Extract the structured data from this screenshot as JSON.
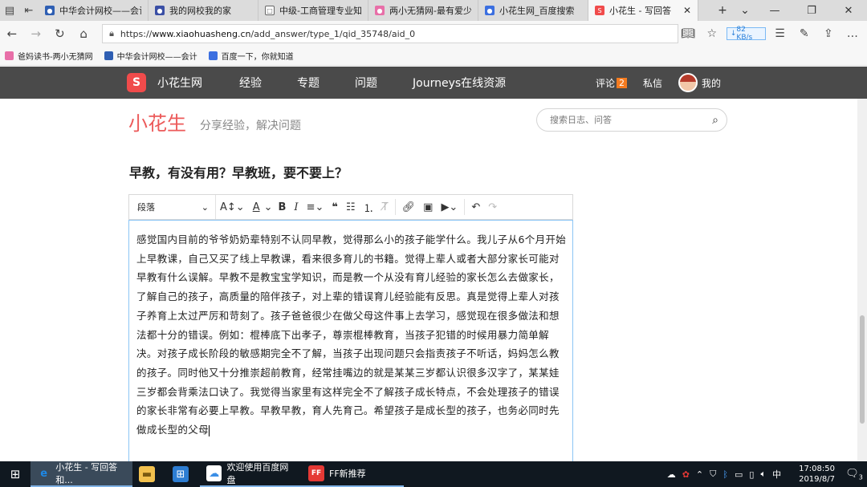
{
  "browser": {
    "tabs": [
      {
        "title": "中华会计网校——会计",
        "fav_color": "#2f5fb3"
      },
      {
        "title": "我的网校我的家",
        "fav_color": "#3a4fa5"
      },
      {
        "title": "中级-工商管理专业知识",
        "fav_color": "#666666"
      },
      {
        "title": "两小无猜网-最有爱少儿",
        "fav_color": "#e86fa8"
      },
      {
        "title": "小花生网_百度搜索",
        "fav_color": "#3b6fe0"
      },
      {
        "title": "小花生 - 写回答",
        "fav_color": "#f04b4b",
        "active": true
      }
    ],
    "new_tab_icon": "plus-icon",
    "url_scheme": "https://",
    "url_host": "www.xiaohuasheng.cn",
    "url_path": "/add_answer/type_1/qid_35748/aid_0",
    "download_speed": "82 KB/s",
    "bookmarks": [
      {
        "label": "爸妈读书-两小无猜网",
        "fav_color": "#e86fa8"
      },
      {
        "label": "中华会计网校——会计",
        "fav_color": "#2f5fb3"
      },
      {
        "label": "百度一下，你就知道",
        "fav_color": "#3b6fe0"
      }
    ]
  },
  "site": {
    "logo_glyph": "S",
    "brand": "小花生网",
    "nav": [
      "经验",
      "专题",
      "问题",
      "Journeys在线资源"
    ],
    "comments_label": "评论",
    "comments_count": "2",
    "messages_label": "私信",
    "me_label": "我的",
    "site_name": "小花生",
    "slogan": "分享经验，解决问题",
    "search_placeholder": "搜索日志、问答"
  },
  "question": {
    "title": "早教，有没有用？早教班，要不要上？"
  },
  "editor": {
    "paragraph_select": "段落",
    "content": "感觉国内目前的爷爷奶奶辈特别不认同早教，觉得那么小的孩子能学什么。我儿子从6个月开始上早教课，自己又买了线上早教课，看来很多育儿的书籍。觉得上辈人或者大部分家长可能对早教有什么误解。早教不是教宝宝学知识，而是教一个从没有育儿经验的家长怎么去做家长，了解自己的孩子，高质量的陪伴孩子，对上辈的错误育儿经验能有反思。真是觉得上辈人对孩子养育上太过严厉和苛刻了。孩子爸爸很少在做父母这件事上去学习，感觉现在很多做法和想法都十分的错误。例如：棍棒底下出孝子，尊崇棍棒教育，当孩子犯错的时候用暴力简单解决。对孩子成长阶段的敏感期完全不了解，当孩子出现问题只会指责孩子不听话，妈妈怎么教的孩子。同时他又十分推崇超前教育，经常挂嘴边的就是某某三岁都认识很多汉字了，某某娃三岁都会背乘法口诀了。我觉得当家里有这样完全不了解孩子成长特点，不会处理孩子的错误的家长非常有必要上早教。早教早教，育人先育己。希望孩子是成长型的孩子，也务必同时先做成长型的父母"
  },
  "taskbar": {
    "items": [
      {
        "label": "小花生 - 写回答 和...",
        "icon": "edge-icon",
        "color": "#1e88e5"
      },
      {
        "label": "",
        "icon": "folder-icon",
        "color": "#f2c14e"
      },
      {
        "label": "",
        "icon": "store-icon",
        "color": "#2d7dd2"
      },
      {
        "label": "欢迎使用百度网盘",
        "icon": "baidu-netdisk-icon",
        "color": "#3a8ee6"
      },
      {
        "label": "FF新推荐",
        "icon": "ff-icon",
        "color": "#e53935"
      }
    ],
    "ime": "中",
    "time": "17:08:50",
    "date": "2019/8/7",
    "notifications": "3"
  }
}
